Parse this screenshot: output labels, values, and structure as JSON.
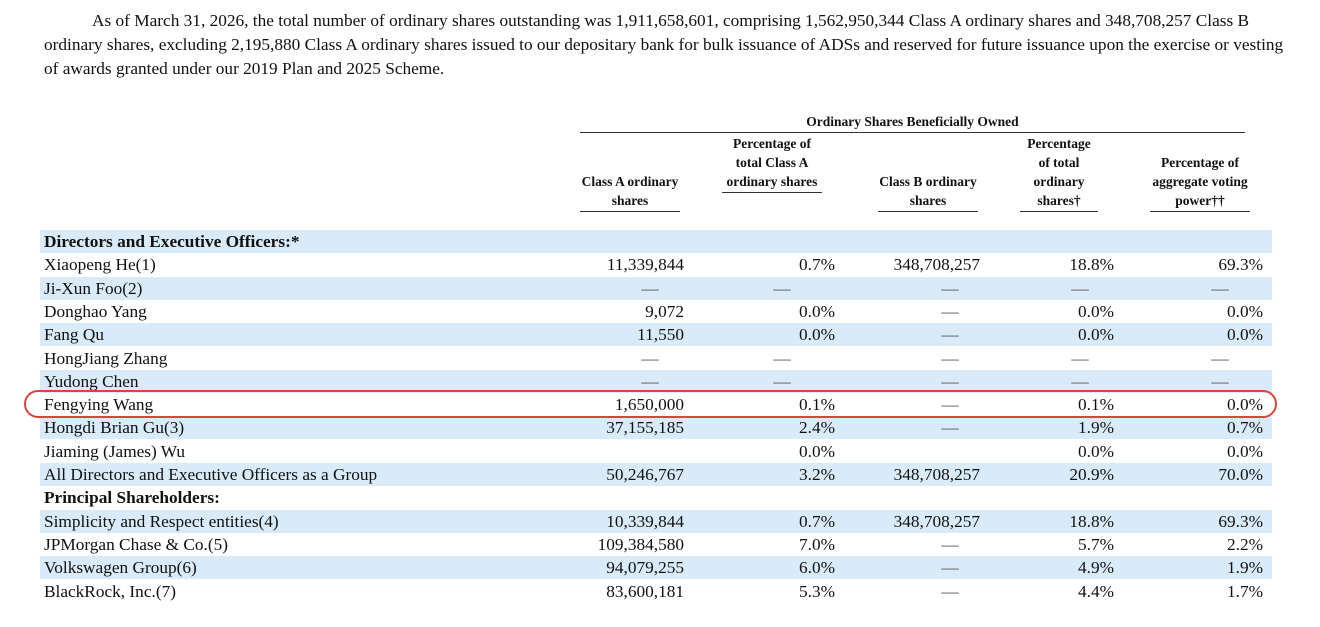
{
  "intro_text": "As of March 31, 2026, the total number of ordinary shares outstanding was 1,911,658,601, comprising 1,562,950,344 Class A ordinary shares and 348,708,257 Class B ordinary shares, excluding 2,195,880 Class A ordinary shares issued to our depositary bank for bulk issuance of ADSs and reserved for future issuance upon the exercise or vesting of awards granted under our 2019 Plan and 2025 Scheme.",
  "table": {
    "group_header": "Ordinary Shares Beneficially Owned",
    "columns": [
      "Class A ordinary shares",
      "Percentage of total Class A ordinary shares",
      "Class B ordinary shares",
      "Percentage of total ordinary shares†",
      "Percentage of aggregate voting power††"
    ],
    "rows": [
      {
        "type": "section",
        "label": "Directors and Executive Officers:*"
      },
      {
        "type": "data",
        "label": "Xiaopeng He(1)",
        "values": [
          "11,339,844",
          "0.7%",
          "348,708,257",
          "18.8%",
          "69.3%"
        ]
      },
      {
        "type": "data",
        "label": "Ji-Xun Foo(2)",
        "values": [
          "—",
          "—",
          "—",
          "—",
          "—"
        ]
      },
      {
        "type": "data",
        "label": "Donghao Yang",
        "values": [
          "9,072",
          "0.0%",
          "—",
          "0.0%",
          "0.0%"
        ]
      },
      {
        "type": "data",
        "label": "Fang Qu",
        "values": [
          "11,550",
          "0.0%",
          "—",
          "0.0%",
          "0.0%"
        ]
      },
      {
        "type": "data",
        "label": "HongJiang Zhang",
        "values": [
          "—",
          "—",
          "—",
          "—",
          "—"
        ]
      },
      {
        "type": "data",
        "label": "Yudong Chen",
        "values": [
          "—",
          "—",
          "—",
          "—",
          "—"
        ]
      },
      {
        "type": "data",
        "label": "Fengying Wang",
        "values": [
          "1,650,000",
          "0.1%",
          "—",
          "0.1%",
          "0.0%"
        ],
        "highlighted": true
      },
      {
        "type": "data",
        "label": "Hongdi Brian Gu(3)",
        "values": [
          "37,155,185",
          "2.4%",
          "—",
          "1.9%",
          "0.7%"
        ]
      },
      {
        "type": "data",
        "label": "Jiaming (James) Wu",
        "values": [
          "",
          "0.0%",
          "",
          "0.0%",
          "0.0%"
        ]
      },
      {
        "type": "data",
        "label": "All Directors and Executive Officers as a Group",
        "values": [
          "50,246,767",
          "3.2%",
          "348,708,257",
          "20.9%",
          "70.0%"
        ]
      },
      {
        "type": "section",
        "label": "Principal Shareholders:"
      },
      {
        "type": "data",
        "label": "Simplicity and Respect entities(4)",
        "values": [
          "10,339,844",
          "0.7%",
          "348,708,257",
          "18.8%",
          "69.3%"
        ]
      },
      {
        "type": "data",
        "label": "JPMorgan Chase & Co.(5)",
        "values": [
          "109,384,580",
          "7.0%",
          "—",
          "5.7%",
          "2.2%"
        ]
      },
      {
        "type": "data",
        "label": "Volkswagen Group(6)",
        "values": [
          "94,079,255",
          "6.0%",
          "—",
          "4.9%",
          "1.9%"
        ]
      },
      {
        "type": "data",
        "label": "BlackRock, Inc.(7)",
        "values": [
          "83,600,181",
          "5.3%",
          "—",
          "4.4%",
          "1.7%"
        ]
      }
    ]
  }
}
